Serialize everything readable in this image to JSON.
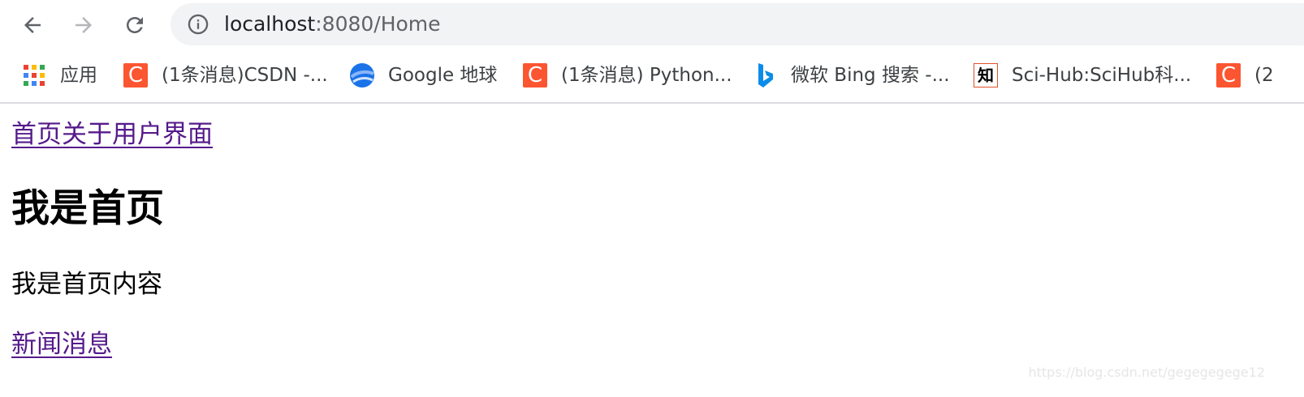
{
  "browser": {
    "url_host": "localhost",
    "url_path": ":8080/Home"
  },
  "bookmarks": {
    "apps_label": "应用",
    "items": [
      {
        "label": "(1条消息)CSDN -...",
        "icon": "csdn-icon"
      },
      {
        "label": "Google 地球",
        "icon": "google-earth-icon"
      },
      {
        "label": "(1条消息) Python...",
        "icon": "csdn-icon"
      },
      {
        "label": "微软 Bing 搜索 -...",
        "icon": "bing-icon"
      },
      {
        "label": "Sci-Hub:SciHub科...",
        "icon": "scihub-icon"
      },
      {
        "label": "(2",
        "icon": "csdn-icon"
      }
    ],
    "csdn_glyph": "C",
    "zhi_glyph": "知"
  },
  "page": {
    "nav_links": [
      "首页",
      "关于",
      "用户",
      "界面"
    ],
    "heading": "我是首页",
    "paragraph": "我是首页内容",
    "news_link": "新闻消息"
  },
  "watermark": "https://blog.csdn.net/gegegegege12",
  "colors": {
    "visited_link": "#551a8b",
    "csdn_red": "#fc5531",
    "omnibox_bg": "#f1f3f4"
  }
}
